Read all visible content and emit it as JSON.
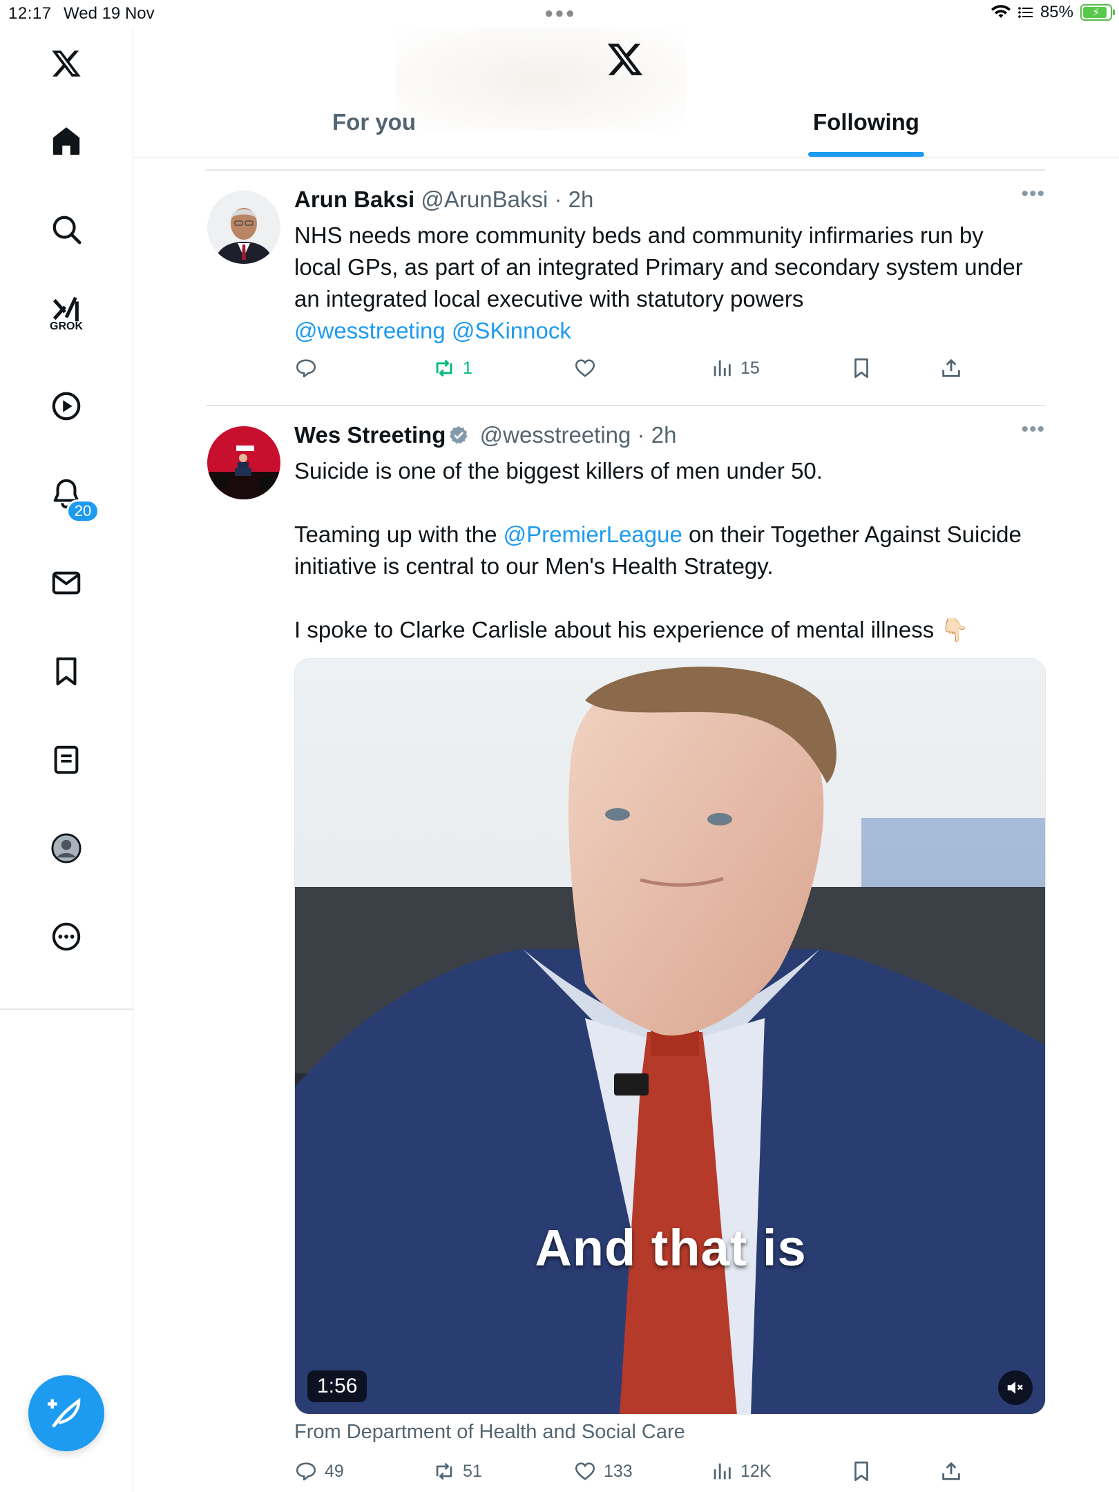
{
  "status_bar": {
    "time": "12:17",
    "date": "Wed 19 Nov",
    "battery": "85%"
  },
  "sidebar": {
    "items": [
      {
        "name": "home-icon"
      },
      {
        "name": "search-icon"
      },
      {
        "name": "grok-icon",
        "label": "GROK"
      },
      {
        "name": "video-icon"
      },
      {
        "name": "notifications-icon",
        "badge": "20"
      },
      {
        "name": "messages-icon"
      },
      {
        "name": "bookmarks-icon"
      },
      {
        "name": "lists-icon"
      },
      {
        "name": "profile-icon"
      },
      {
        "name": "more-icon"
      }
    ]
  },
  "header": {
    "tabs": [
      {
        "label": "For you",
        "active": false
      },
      {
        "label": "Following",
        "active": true
      }
    ]
  },
  "colors": {
    "accent": "#1d9bf0",
    "text": "#0f1419",
    "secondary": "#536471",
    "retweet_active": "#00ba7c"
  },
  "tweets": [
    {
      "name": "Arun Baksi",
      "handle": "@ArunBaksi",
      "time": "2h",
      "verified": false,
      "text_line_1": "NHS needs more community beds and community infirmaries run by",
      "text_line_2": "local GPs, as part of an integrated Primary and secondary system under",
      "text_line_3": "an integrated local executive with statutory powers",
      "mention_1": "@wesstreeting",
      "mention_2": "@SKinnock",
      "replies": "",
      "retweets": "1",
      "likes": "",
      "views": "15"
    },
    {
      "name": "Wes Streeting",
      "handle": "@wesstreeting",
      "time": "2h",
      "verified": true,
      "para_1": "Suicide is one of the biggest killers of men under 50.",
      "para_2_a": "Teaming up with the ",
      "para_2_mention": "@PremierLeague",
      "para_2_b": " on their Together Against Suicide",
      "para_2_c": "initiative is central to our Men's Health Strategy.",
      "para_3": "I spoke to Clarke Carlisle about his experience of mental illness 👇🏻",
      "video": {
        "caption": "And that is",
        "duration": "1:56",
        "source": "From Department of Health and Social Care"
      },
      "replies": "49",
      "retweets": "51",
      "likes": "133",
      "views": "12K"
    }
  ]
}
